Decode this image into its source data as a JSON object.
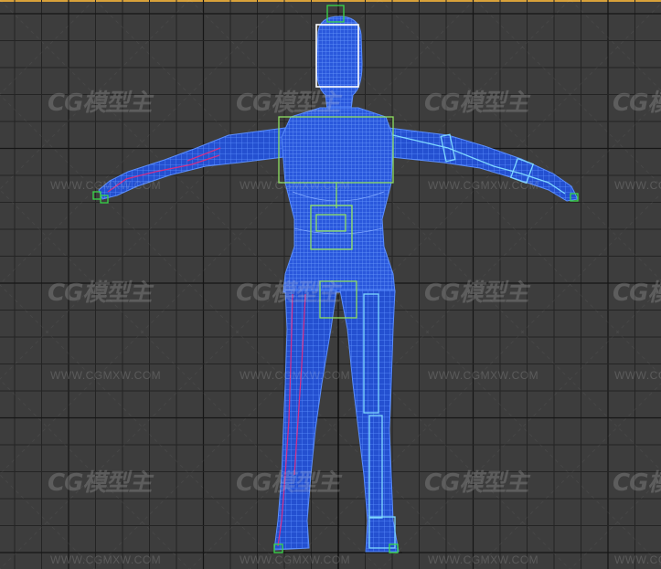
{
  "viewport": {
    "name": "front",
    "colors": {
      "background": "#3d3d3d",
      "grid": "#242424",
      "grid_major": "#161616",
      "mesh": "#2f5fe0",
      "mesh_bright": "#4a84ff",
      "selection_box": "#ffffff",
      "bone_green": "#39d94a",
      "bone_cyan": "#7fd8ff",
      "bone_magenta": "#d0308a",
      "active_border": "#d8a13a"
    }
  },
  "watermark": {
    "logo_text": "CG模型主",
    "url_text": "WWW.CGMXW.COM"
  }
}
